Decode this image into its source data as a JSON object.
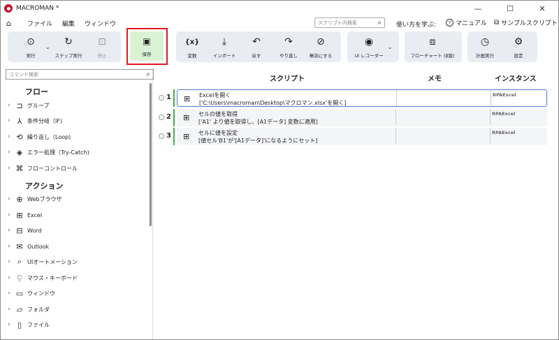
{
  "window": {
    "title": "MACROMAN *",
    "minimize": "—",
    "maximize": "☐",
    "close": "✕"
  },
  "menu": {
    "items": [
      "ファイル",
      "編集",
      "ウィンドウ"
    ],
    "search_placeholder": "スクリプト内検索",
    "help_label": "使い方を学ぶ:",
    "manual": "マニュアル",
    "sample": "サンプルスクリプト"
  },
  "toolbar": {
    "run": "実行",
    "step_run": "ステップ実行",
    "stop": "停止",
    "save": "保存",
    "variable": "変数",
    "import": "インポート",
    "undo": "戻す",
    "redo": "やり直し",
    "disable": "無効にする",
    "ui_recorder": "UI レコーダー",
    "flowchart": "フローチャート (β版)",
    "schedule": "計画実行",
    "settings": "設定"
  },
  "left": {
    "search_placeholder": "コマンド検索",
    "flow_title": "フロー",
    "flow_items": [
      "グループ",
      "条件分岐（IF)",
      "繰り返し（Loop)",
      "エラー処理（Try-Catch)",
      "フローコントロール"
    ],
    "action_title": "アクション",
    "action_items": [
      "Webブラウザ",
      "Excel",
      "Word",
      "Outlook",
      "UIオートメーション",
      "マウス・キーボード",
      "ウィンドウ",
      "フォルダ",
      "ファイル"
    ]
  },
  "main": {
    "headers": {
      "script": "スクリプト",
      "memo": "メモ",
      "instance": "インスタンス"
    },
    "rows": [
      {
        "num": "1",
        "line1": "Excelを開く",
        "line2": "['C:\\Users\\macroman\\Desktop\\マクロマン.xlsx'を開く]",
        "instance": "RPAExcel"
      },
      {
        "num": "2",
        "line1": "セルの値を取得",
        "line2": "['A1' より値を取得し、[A1データ] 変数に適用]",
        "instance": "RPAExcel"
      },
      {
        "num": "3",
        "line1": "セルに値を設定",
        "line2": "[値セル'B1'が'[A1データ]'になるようにセット]",
        "instance": "RPAExcel"
      }
    ]
  },
  "colors": {
    "accent": "#4a7fd6",
    "save_highlight": "#e0191c",
    "save_bg": "#d9f2d4",
    "group_bg": "#e9ecf3",
    "row_bar": "#3cb043"
  }
}
